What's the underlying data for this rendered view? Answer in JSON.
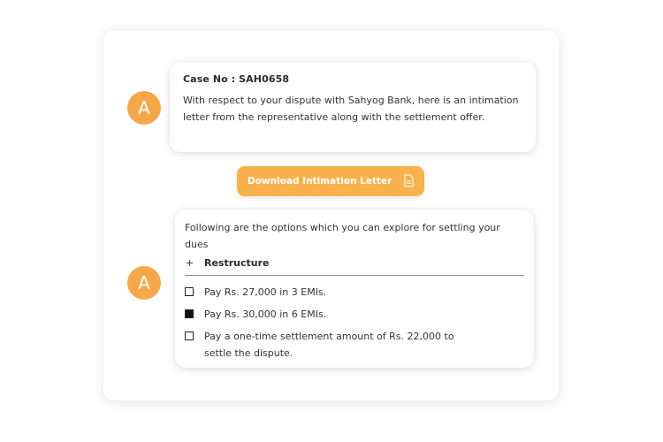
{
  "conversation": {
    "messages": [
      {
        "avatar_letter": "A",
        "case_label": "Case No : SAH0658",
        "text": "With respect to your dispute with Sahyog Bank, here is an intimation letter from the representative along with the settlement offer."
      }
    ],
    "download_button": {
      "label": "Download Intimation Letter",
      "icon": "document-icon",
      "color": "#f9b14c"
    },
    "options_message": {
      "avatar_letter": "A",
      "intro": "Following are the options which you can explore for settling your dues",
      "section": {
        "toggle": "+",
        "label": "Restructure"
      },
      "options": [
        {
          "label": "Pay Rs. 27,000 in 3 EMIs.",
          "checked": false
        },
        {
          "label": "Pay Rs. 30,000 in 6 EMIs.",
          "checked": true
        },
        {
          "label": "Pay a one-time settlement amount of Rs. 22,000 to settle the dispute.",
          "checked": false
        }
      ]
    }
  },
  "colors": {
    "accent": "#f5a84a",
    "text": "#2b2b2b"
  }
}
